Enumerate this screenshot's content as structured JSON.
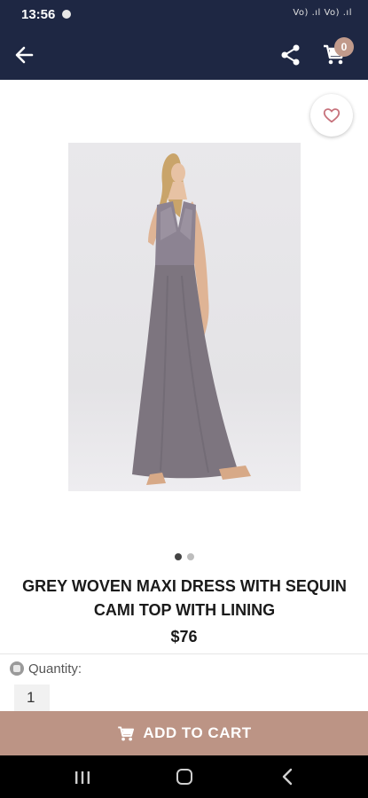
{
  "status_bar": {
    "time": "13:56",
    "right_text": "Vo) .ıl Vo) .ıl"
  },
  "app_bar": {
    "back_icon": "arrow-left-icon",
    "share_icon": "share-icon",
    "cart_icon": "cart-icon",
    "cart_count": "0"
  },
  "product": {
    "title": "GREY WOVEN MAXI DRESS WITH SEQUIN CAMI TOP WITH LINING",
    "price": "$76",
    "image_count": 2,
    "active_image": 1
  },
  "quantity": {
    "label": "Quantity:",
    "value": "1"
  },
  "add_to_cart": {
    "label": "ADD TO CART"
  },
  "colors": {
    "app_bar": "#1e2743",
    "accent": "#bc9485",
    "badge": "#c19a8b",
    "favorite": "#c7727c"
  }
}
